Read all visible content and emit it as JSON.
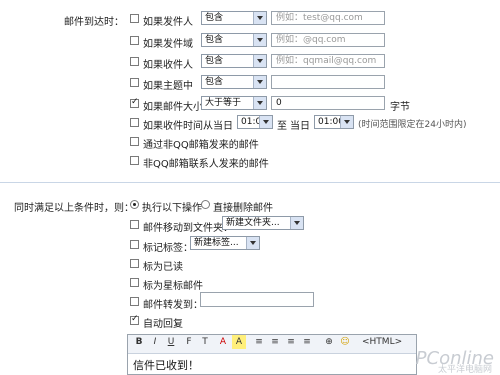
{
  "conditions": {
    "section_label": "邮件到达时：",
    "rows": [
      {
        "label": "如果发件人",
        "operator": "包含",
        "placeholder": "例如：test@qq.com",
        "value": "",
        "checked": false
      },
      {
        "label": "如果发件域",
        "operator": "包含",
        "placeholder": "例如：@qq.com",
        "value": "",
        "checked": false
      },
      {
        "label": "如果收件人",
        "operator": "包含",
        "placeholder": "例如：qqmail@qq.com",
        "value": "",
        "checked": false
      },
      {
        "label": "如果主题中",
        "operator": "包含",
        "placeholder": "",
        "value": "",
        "checked": false
      },
      {
        "label": "如果邮件大小",
        "operator": "大于等于",
        "placeholder": "",
        "value": "0",
        "unit": "字节",
        "checked": true
      }
    ],
    "time_row": {
      "label": "如果收件时间从当日",
      "from": "01:00",
      "to_label": "至",
      "day_label": "当日",
      "to": "01:00",
      "note": "(时间范围限定在24小时内)",
      "checked": false
    },
    "extra_options": [
      {
        "label": "通过非QQ邮箱发来的邮件",
        "checked": false
      },
      {
        "label": "非QQ邮箱联系人发来的邮件",
        "checked": false
      }
    ]
  },
  "actions": {
    "section_label": "同时满足以上条件时，则：",
    "radio_options": [
      {
        "label": "执行以下操作",
        "selected": true
      },
      {
        "label": "直接删除邮件",
        "selected": false
      }
    ],
    "move_label": "邮件移动到文件夹：",
    "move_select": "新建文件夹...",
    "tag_label": "标记标签：",
    "tag_select": "新建标签...",
    "mark_read": "标为已读",
    "mark_star": "标为星标邮件",
    "forward_label": "邮件转发到：",
    "forward_value": "",
    "auto_reply_label": "自动回复",
    "auto_reply_checked": true,
    "toolbar": [
      "B",
      "I",
      "U",
      "F",
      "T",
      "A",
      "A",
      "≡",
      "≡",
      "≡",
      "≡",
      "⊕",
      "☺",
      "<HTML>"
    ],
    "reply_text": "信件已收到！"
  },
  "watermark": {
    "brand": "PConline",
    "sub": "太平洋电脑网"
  }
}
